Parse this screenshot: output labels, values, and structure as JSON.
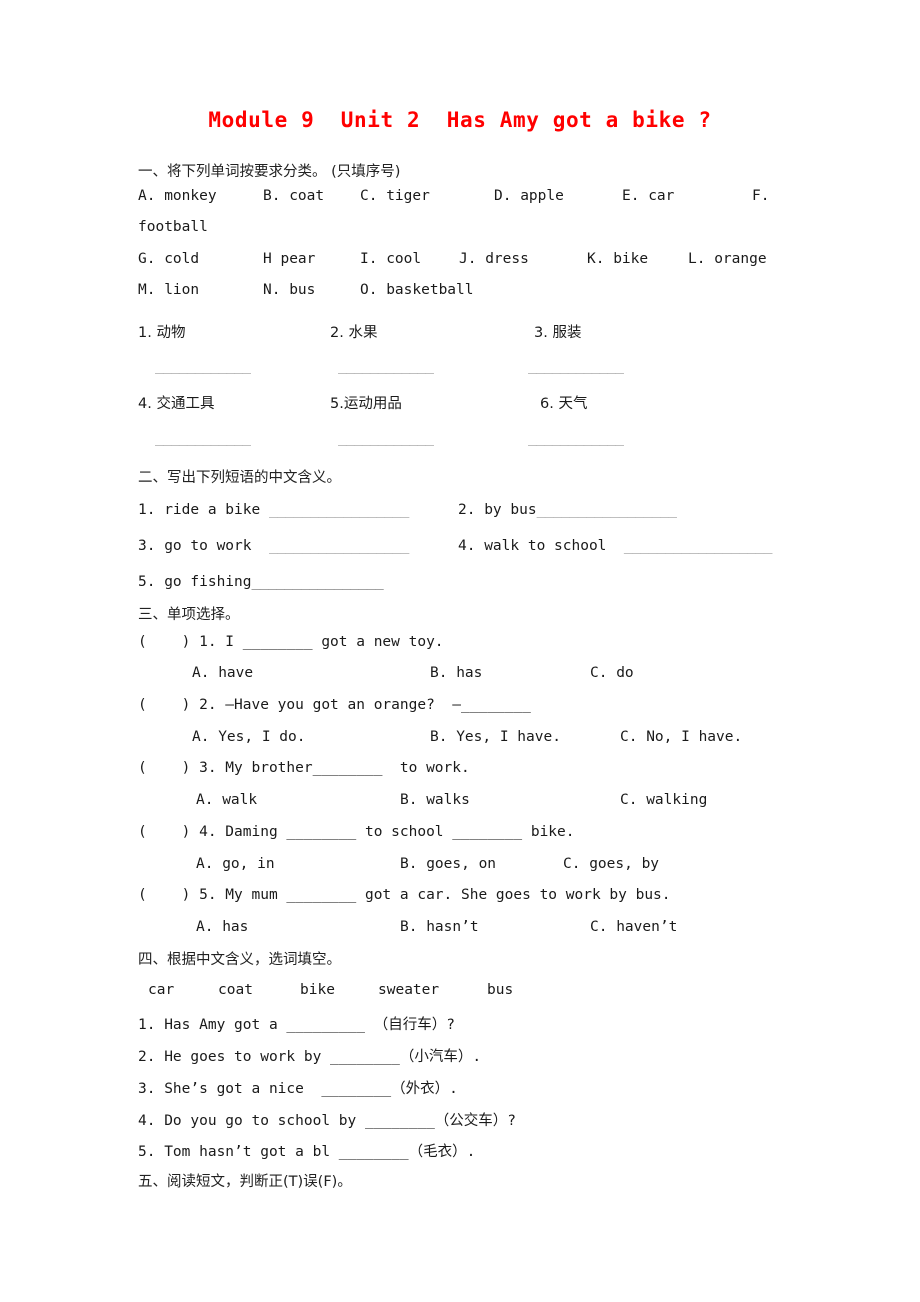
{
  "document": {
    "title": "Module 9  Unit 2  Has Amy got a bike ?",
    "title_color": "#ff0000"
  },
  "section1": {
    "heading": "一、将下列单词按要求分类。 (只填序号)",
    "word_bank_line1": [
      {
        "label": "A. monkey"
      },
      {
        "label": "B. coat"
      },
      {
        "label": "C. tiger"
      },
      {
        "label": "D. apple"
      },
      {
        "label": "E. car"
      },
      {
        "label": "F."
      }
    ],
    "word_bank_line2": "football",
    "word_bank_line3": [
      {
        "label": "G. cold"
      },
      {
        "label": "H pear"
      },
      {
        "label": "I. cool"
      },
      {
        "label": "J. dress"
      },
      {
        "label": "K. bike"
      },
      {
        "label": "L. orange"
      }
    ],
    "word_bank_line4": [
      {
        "label": "M. lion"
      },
      {
        "label": "N. bus"
      },
      {
        "label": "O. basketball"
      }
    ],
    "categories_row1": [
      {
        "label": "1. 动物"
      },
      {
        "label": "2. 水果"
      },
      {
        "label": "3. 服装"
      }
    ],
    "categories_row2": [
      {
        "label": "4. 交通工具"
      },
      {
        "label": "5.运动用品"
      },
      {
        "label": "6. 天气"
      }
    ],
    "blank": "____________"
  },
  "section2": {
    "heading": "二、写出下列短语的中文含义。",
    "items": [
      {
        "text": "1. ride a bike ",
        "blank": "_________________"
      },
      {
        "text": "2. by bus",
        "blank": "_________________"
      },
      {
        "text": "3. go to work  ",
        "blank": "_________________"
      },
      {
        "text": "4. walk to school  ",
        "blank": "__________________"
      },
      {
        "text": "5. go fishing",
        "blank": "________________"
      }
    ]
  },
  "section3": {
    "heading": "三、单项选择。",
    "questions": [
      {
        "stem": "(    ) 1. I ________ got a new toy.",
        "options": [
          "A. have",
          "B. has",
          "C. do"
        ]
      },
      {
        "stem": "(    ) 2. —Have you got an orange?  —________",
        "options": [
          "A. Yes, I do.",
          "B. Yes, I have.",
          "C. No, I have."
        ]
      },
      {
        "stem": "(    ) 3. My brother________  to work.",
        "options": [
          "A. walk",
          "B. walks",
          "C. walking"
        ]
      },
      {
        "stem": "(    ) 4. Daming ________ to school ________ bike.",
        "options": [
          "A. go, in",
          "B. goes, on",
          "C. goes, by"
        ]
      },
      {
        "stem": "(    ) 5. My mum ________ got a car. She goes to work by bus.",
        "options": [
          "A. has",
          "B. hasn’t",
          "C. haven’t"
        ]
      }
    ]
  },
  "section4": {
    "heading": "四、根据中文含义，选词填空。",
    "word_bank": [
      "car",
      "coat",
      "bike",
      "sweater",
      "bus"
    ],
    "items": [
      "1. Has Amy got a _________ （自行车）?",
      "2. He goes to work by ________（小汽车）.",
      "3. She’s got a nice  ________（外衣）.",
      "4. Do you go to school by ________（公交车）?",
      "5. Tom hasn’t got a bl ________（毛衣）."
    ]
  },
  "section5": {
    "heading": "五、阅读短文，判断正(T)误(F)。"
  }
}
